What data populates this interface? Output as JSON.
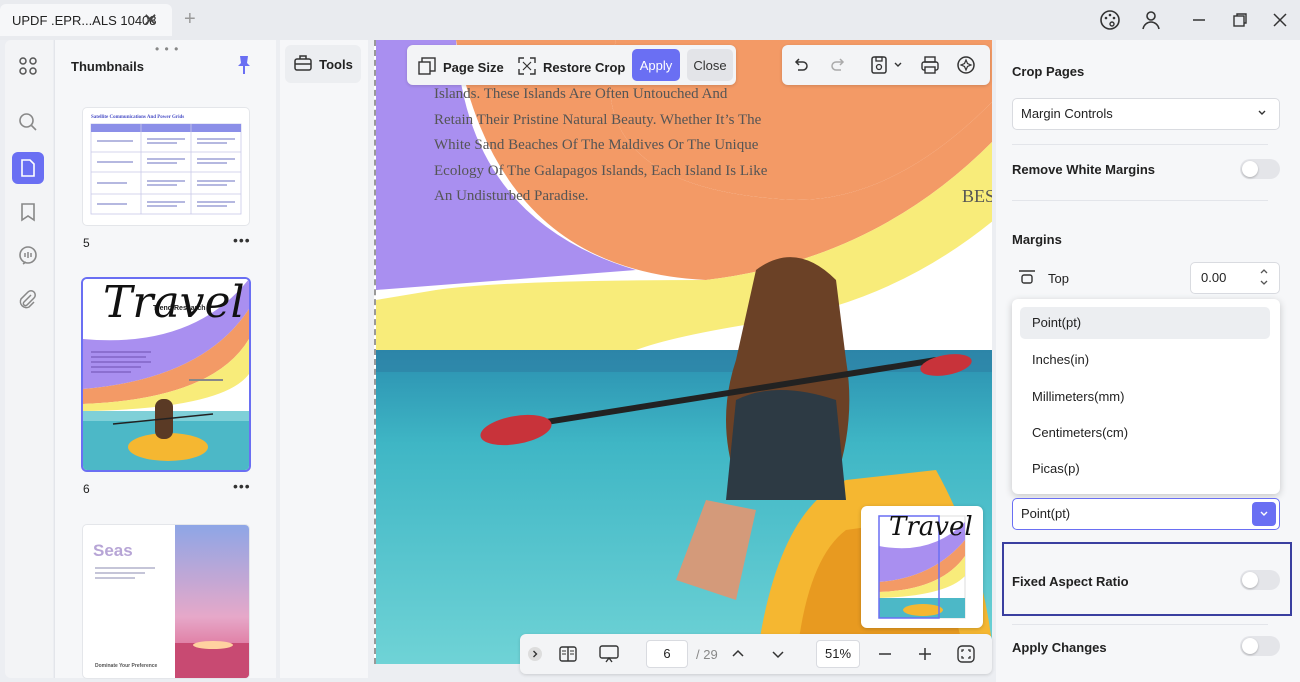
{
  "window": {
    "tab_title": "UPDF .EPR...ALS 10408",
    "close_symbol": "✕",
    "new_tab_symbol": "+"
  },
  "thumbnails": {
    "title": "Thumbnails",
    "grip": "• • •",
    "pages": [
      {
        "number": "5",
        "more": "•••"
      },
      {
        "number": "6",
        "more": "•••"
      },
      {
        "number": "",
        "more": ""
      }
    ],
    "thumb5_heading": "Satellite Communications And Power Grids",
    "thumb6_title": "Travel",
    "thumb6_subtitle": "Trend Research",
    "thumb7_title": "Seas",
    "thumb7_footer": "Dominate Your Preference"
  },
  "tools": {
    "label": "Tools"
  },
  "crop_toolbar": {
    "page_size": "Page Size",
    "restore_crop": "Restore Crop",
    "apply": "Apply",
    "close": "Close"
  },
  "canvas": {
    "text_lines": [
      "Islands. These Islands Are Often Untouched And",
      "Retain Their Pristine Natural Beauty. Whether It’s The",
      "White Sand Beaches Of The Maldives Or The Unique",
      "Ecology Of The Galapagos Islands, Each Island Is Like",
      "An Undisturbed Paradise."
    ],
    "side_text": "BES"
  },
  "bottom_bar": {
    "page_current": "6",
    "page_total": "/ 29",
    "zoom": "51%"
  },
  "right_panel": {
    "crop_pages_title": "Crop Pages",
    "crop_mode": "Margin Controls",
    "remove_white_margins": "Remove White Margins",
    "margins_title": "Margins",
    "top_label": "Top",
    "top_value": "0.00",
    "unit_options": [
      "Point(pt)",
      "Inches(in)",
      "Millimeters(mm)",
      "Centimeters(cm)",
      "Picas(p)"
    ],
    "unit_selected": "Point(pt)",
    "fixed_aspect_ratio": "Fixed Aspect Ratio",
    "apply_changes": "Apply Changes"
  },
  "colors": {
    "accent": "#6a6ff3",
    "highlight_border": "#3a3fa0"
  },
  "icons": [
    "apps-icon",
    "search-icon",
    "page-icon",
    "bookmark-icon",
    "comment-icon",
    "attachment-icon",
    "pin-icon",
    "palette-icon",
    "user-icon",
    "minimize-icon",
    "restore-icon",
    "close-icon",
    "toolbox-icon",
    "page-size-icon",
    "restore-crop-icon",
    "undo-icon",
    "redo-icon",
    "save-icon",
    "print-icon",
    "ai-icon",
    "chevron-right-icon",
    "two-page-icon",
    "presentation-icon",
    "chevron-up-icon",
    "chevron-down-icon",
    "zoom-out-icon",
    "zoom-in-icon",
    "fit-icon",
    "margin-top-icon"
  ]
}
